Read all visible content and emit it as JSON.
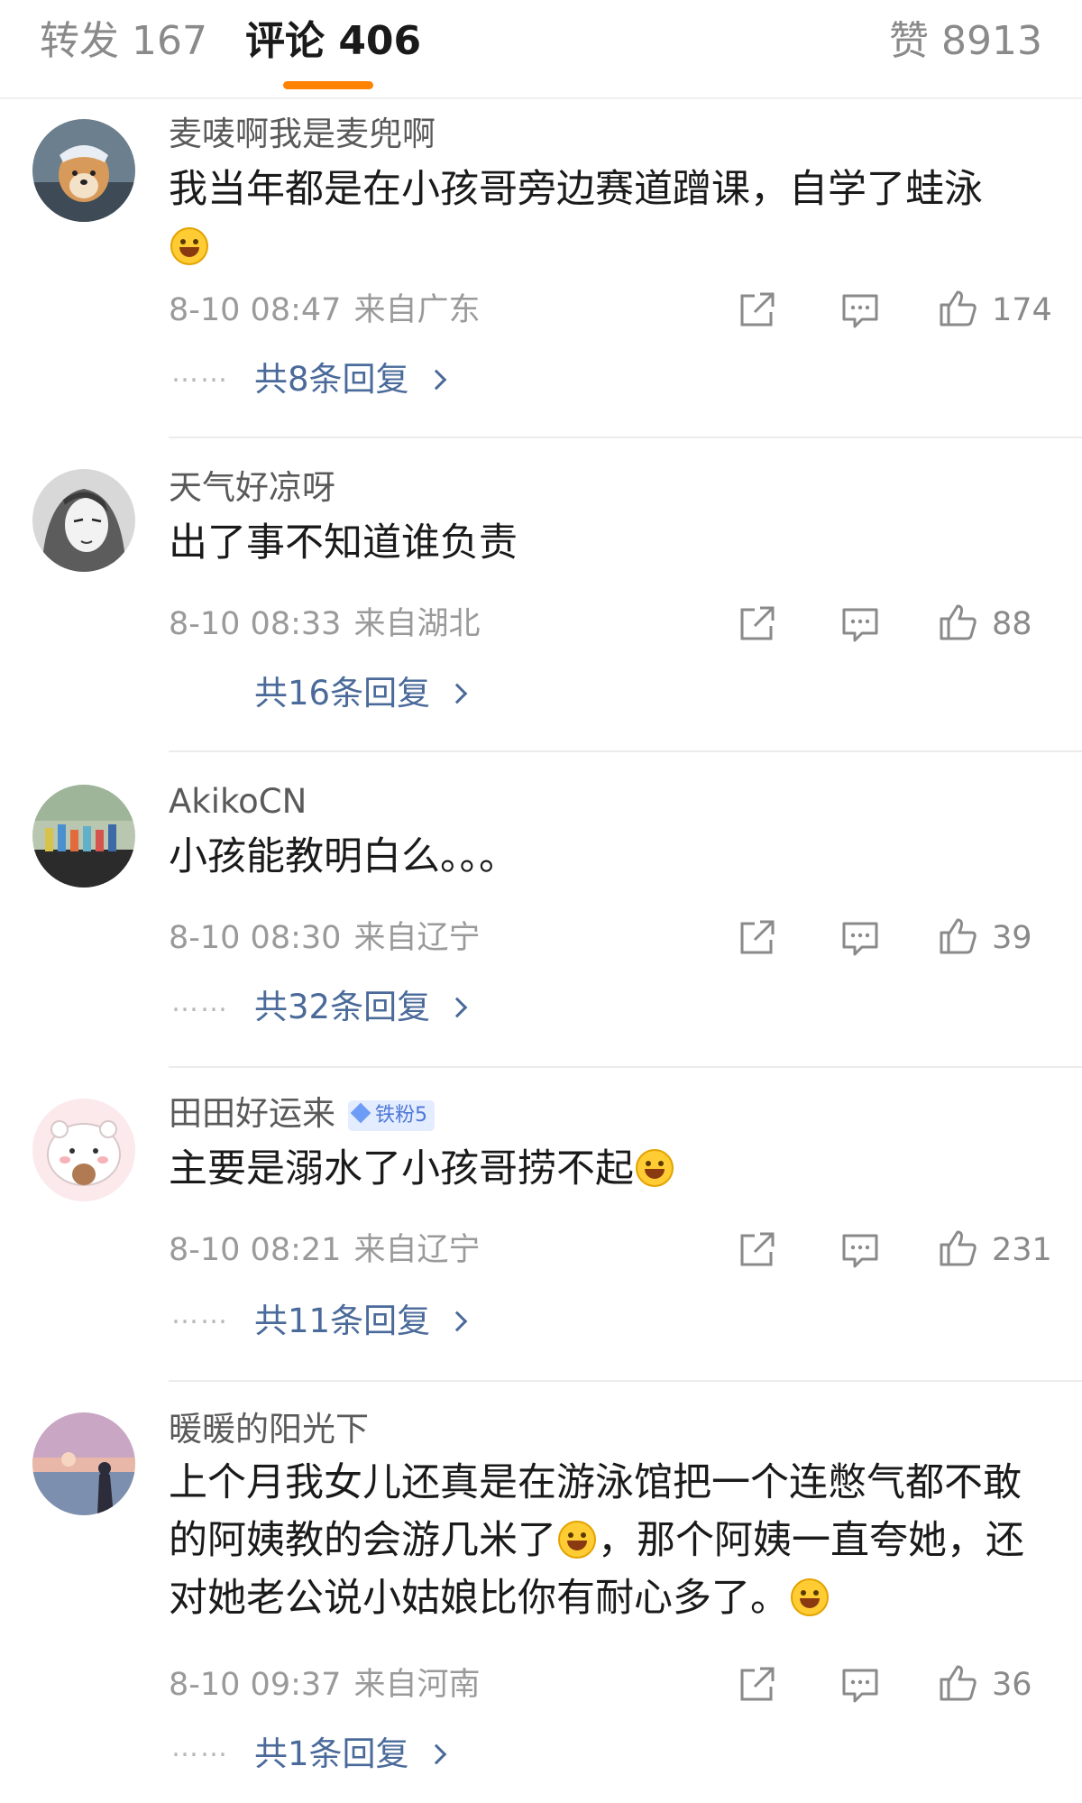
{
  "tabs": {
    "repost": "转发 167",
    "comments": "评论 406",
    "likes": "赞 8913"
  },
  "comments": [
    {
      "username": "麦唛啊我是麦兜啊",
      "text": "我当年都是在小孩哥旁边赛道蹭课，自学了蛙泳",
      "emoji": "laughing-tears-emoji",
      "time": "8-10 08:47",
      "location": "来自广东",
      "likes": "174",
      "replies": "共8条回复"
    },
    {
      "username": "天气好凉呀",
      "text": "出了事不知道谁负责",
      "time": "8-10 08:33",
      "location": "来自湖北",
      "likes": "88",
      "replies": "共16条回复"
    },
    {
      "username": "AkikoCN",
      "text": "小孩能教明白么。。。",
      "time": "8-10 08:30",
      "location": "来自辽宁",
      "likes": "39",
      "replies": "共32条回复"
    },
    {
      "username": "田田好运来",
      "badge": "铁粉5",
      "text": "主要是溺水了小孩哥捞不起",
      "emoji": "grinning-emoji",
      "time": "8-10 08:21",
      "location": "来自辽宁",
      "likes": "231",
      "replies": "共11条回复"
    },
    {
      "username": "暖暖的阳光下",
      "text_part1": "上个月我女儿还真是在游泳馆把一个连憋气都不敢的阿姨教的会游几米了",
      "text_part2": "，那个阿姨一直夸她，还对她老公说小姑娘比你有耐心多了。",
      "emoji1": "crying-emoji",
      "emoji2": "grin-teeth-emoji",
      "time": "8-10 09:37",
      "location": "来自河南",
      "likes": "36",
      "replies": "共1条回复"
    }
  ],
  "dots": "……",
  "colors": {
    "accent": "#ff8200",
    "reply_link": "#4a6a9a",
    "meta_text": "#9a9a9a"
  }
}
